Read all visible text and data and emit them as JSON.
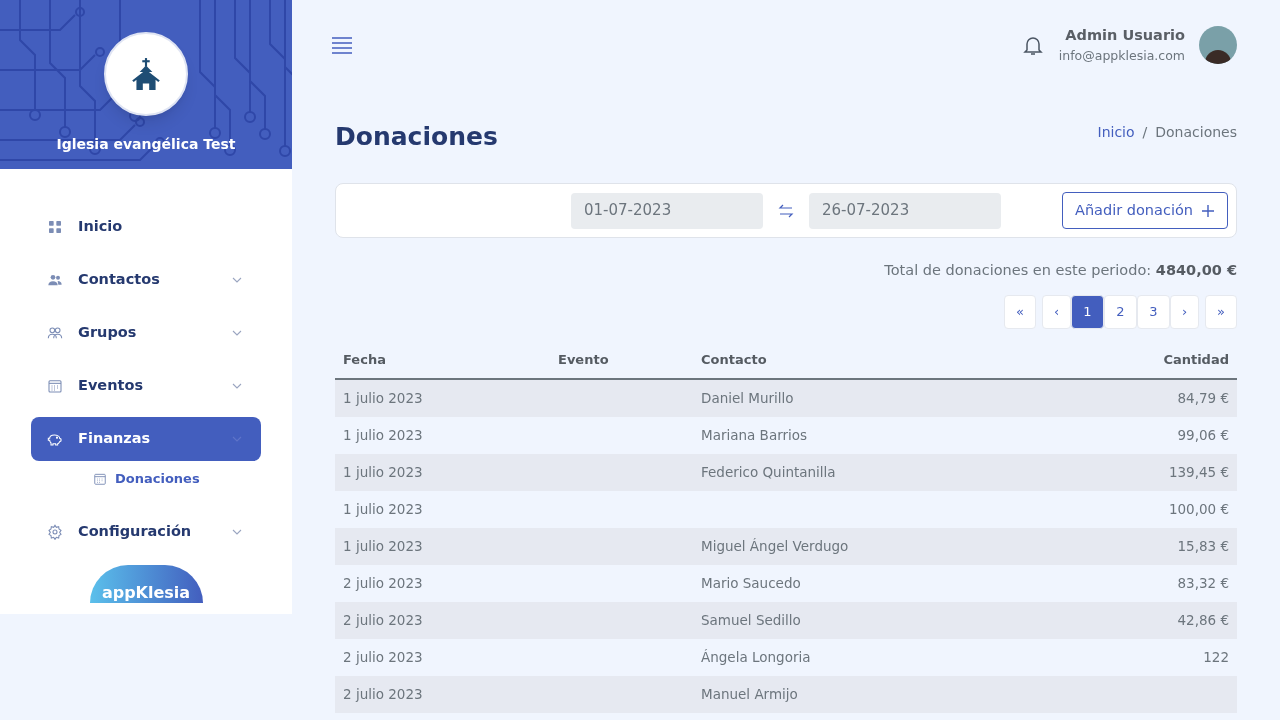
{
  "sidebar": {
    "org_name": "Iglesia evangélica Test",
    "items": [
      {
        "label": "Inicio",
        "kind": "grid",
        "expandable": false,
        "selected": false
      },
      {
        "label": "Contactos",
        "kind": "people",
        "expandable": true,
        "selected": false
      },
      {
        "label": "Grupos",
        "kind": "group",
        "expandable": true,
        "selected": false
      },
      {
        "label": "Eventos",
        "kind": "calendar",
        "expandable": true,
        "selected": false
      },
      {
        "label": "Finanzas",
        "kind": "piggy",
        "expandable": true,
        "selected": true,
        "children": [
          {
            "label": "Donaciones",
            "kind": "calendar",
            "selected": true
          }
        ]
      },
      {
        "label": "Configuración",
        "kind": "gear",
        "expandable": true,
        "selected": false
      }
    ],
    "logo_text": "appKlesia"
  },
  "header": {
    "user_name": "Admin Usuario",
    "user_email": "info@appklesia.com"
  },
  "page_title": "Donaciones",
  "breadcrumb": [
    {
      "label": "Inicio",
      "link": true
    },
    {
      "label": "/",
      "link": false
    },
    {
      "label": "Donaciones",
      "link": false
    }
  ],
  "filter": {
    "date_from": "01-07-2023",
    "date_to": "26-07-2023",
    "add_button": "Añadir donación"
  },
  "total": {
    "label": "Total de donaciones en este periodo:",
    "value": "4840,00 €"
  },
  "pagination": [
    {
      "label": "«",
      "selected": false
    },
    {
      "label": "‹",
      "selected": false
    },
    {
      "label": "1",
      "selected": true
    },
    {
      "label": "2",
      "selected": false
    },
    {
      "label": "3",
      "selected": false
    },
    {
      "label": "›",
      "selected": false
    },
    {
      "label": "»",
      "selected": false
    }
  ],
  "table": {
    "columns": [
      "Fecha",
      "Evento",
      "Contacto",
      "Cantidad"
    ],
    "rows": [
      [
        "1 julio 2023",
        "",
        "Daniel Murillo",
        "84,79 €"
      ],
      [
        "1 julio 2023",
        "",
        "Mariana Barrios",
        "99,06 €"
      ],
      [
        "1 julio 2023",
        "",
        "Federico Quintanilla",
        "139,45 €"
      ],
      [
        "1 julio 2023",
        "",
        "",
        "100,00 €"
      ],
      [
        "1 julio 2023",
        "",
        "Miguel Ángel Verdugo",
        "15,83 €"
      ],
      [
        "2 julio 2023",
        "",
        "Mario Saucedo",
        "83,32 €"
      ],
      [
        "2 julio 2023",
        "",
        "Samuel Sedillo",
        "42,86 €"
      ],
      [
        "2 julio 2023",
        "",
        "Ángela Longoria",
        "122"
      ],
      [
        "2 julio 2023",
        "",
        "Manuel Armijo",
        ""
      ]
    ]
  }
}
